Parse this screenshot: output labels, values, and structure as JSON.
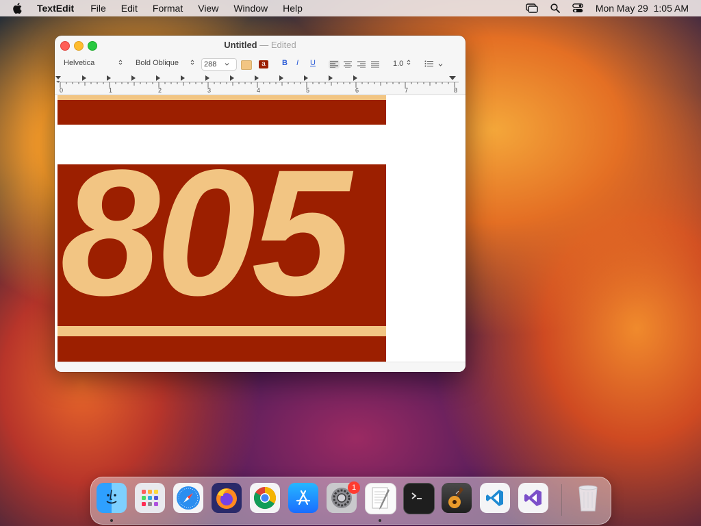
{
  "menubar": {
    "app_name": "TextEdit",
    "items": [
      "File",
      "Edit",
      "Format",
      "View",
      "Window",
      "Help"
    ],
    "datetime": "Mon May 29  1:05 AM"
  },
  "window": {
    "title": "Untitled",
    "separator": "—",
    "status": "Edited"
  },
  "toolbar": {
    "font_family": "Helvetica",
    "font_style": "Bold Oblique",
    "font_size": "288",
    "bold_label": "B",
    "italic_label": "I",
    "underline_label": "U",
    "text_color_label": "a",
    "line_spacing": "1.0",
    "highlight_color": "#f2c583",
    "text_color": "#9c1f00"
  },
  "ruler": {
    "marks": [
      "0",
      "1",
      "2",
      "3",
      "4",
      "5",
      "6",
      "7",
      "8"
    ]
  },
  "document": {
    "text": "805",
    "text_color": "#f2c583",
    "background_color": "#9c1f00"
  },
  "dock": {
    "apps": [
      "finder-icon",
      "launchpad-icon",
      "safari-icon",
      "firefox-icon",
      "chrome-icon",
      "app-store-icon",
      "system-settings-icon",
      "textedit-icon",
      "terminal-icon",
      "garageband-icon",
      "vscode-icon",
      "visual-studio-icon",
      "trash-icon"
    ],
    "settings_badge": "1"
  }
}
